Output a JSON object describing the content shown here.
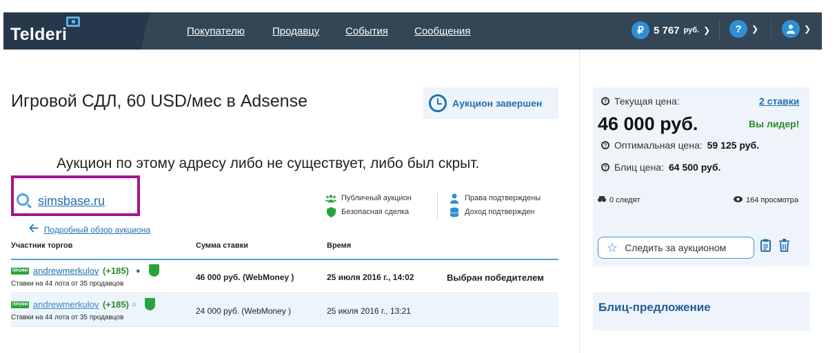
{
  "header": {
    "logo": "Telderi",
    "nav": [
      "Покупателю",
      "Продавцу",
      "События",
      "Сообщения"
    ],
    "balance_icon": "₽",
    "balance_amount": "5 767",
    "balance_currency": "руб.",
    "help_icon": "?",
    "user_icon": "user-icon"
  },
  "main": {
    "title": "Игровой СДЛ, 60 USD/мес в Adsense",
    "status": "Аукцион завершен",
    "notice": "Аукцион по этому адресу либо не существует, либо был скрыт.",
    "domain": "simsbase.ru",
    "back_link": "Подробный обзор аукциона",
    "features": {
      "public": "Публичный аукцион",
      "safe": "Безопасная сделка",
      "rights": "Права подтверждены",
      "income": "Доход подтвержден"
    }
  },
  "table": {
    "headers": [
      "Участник торгов",
      "Сумма ставки",
      "Время"
    ],
    "rows": [
      {
        "badge": "ПРОФИ",
        "user": "andrewmerkulov",
        "rating": "(+185)",
        "sub": "Ставки на 44 лота от 35 продавцов",
        "amount": "46 000 руб. (WebMoney )",
        "time": "25 июля 2016 г., 14:02",
        "result": "Выбран победителем"
      },
      {
        "badge": "ПРОФИ",
        "user": "andrewmerkulov",
        "rating": "(+185)",
        "sub": "Ставки на 44 лота от 35 продавцов",
        "amount": "24 000 руб. (WebMoney )",
        "time": "25 июля 2016 г., 13:21",
        "result": ""
      }
    ]
  },
  "sidebar": {
    "current_price_label": "Текущая цена:",
    "bids_link": "2 ставки",
    "price": "46 000 руб.",
    "leader": "Вы лидер!",
    "optimal_label": "Оптимальная цена:",
    "optimal_value": "59 125 руб.",
    "blitz_label": "Блиц цена:",
    "blitz_value": "64 500 руб.",
    "watchers": "0 следят",
    "views": "164 просмотра",
    "follow_button": "Следить за аукционом",
    "blitz_offer": "Блиц-предложение"
  },
  "colors": {
    "header_bg": "#344556",
    "accent_blue": "#1f6fb3",
    "success_green": "#2a8a2a",
    "highlight_border": "#a3148c"
  }
}
